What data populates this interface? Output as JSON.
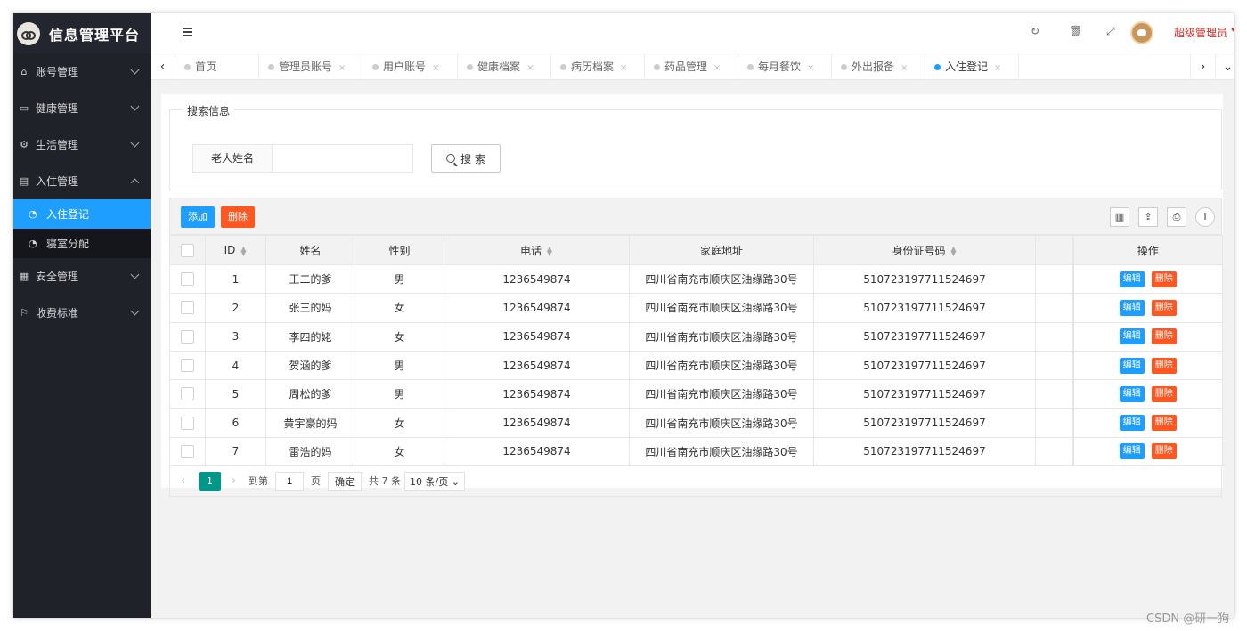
{
  "app": {
    "title": "信息管理平台"
  },
  "header": {
    "user_name": "超级管理员"
  },
  "sidebar": {
    "items": [
      {
        "label": "账号管理",
        "icon": "home-icon"
      },
      {
        "label": "健康管理",
        "icon": "window-icon"
      },
      {
        "label": "生活管理",
        "icon": "gears-icon"
      },
      {
        "label": "入住管理",
        "icon": "file-icon"
      },
      {
        "label": "安全管理",
        "icon": "calendar-icon"
      },
      {
        "label": "收费标准",
        "icon": "flag-icon"
      }
    ],
    "sub_items": [
      {
        "label": "入住登记",
        "icon": "dashboard-icon",
        "active": true
      },
      {
        "label": "寝室分配",
        "icon": "dashboard-icon",
        "active": false
      }
    ]
  },
  "tabs": [
    {
      "label": "首页"
    },
    {
      "label": "管理员账号",
      "close": "×"
    },
    {
      "label": "用户账号",
      "close": "×"
    },
    {
      "label": "健康档案",
      "close": "×"
    },
    {
      "label": "病历档案",
      "close": "×"
    },
    {
      "label": "药品管理",
      "close": "×"
    },
    {
      "label": "每月餐饮",
      "close": "×"
    },
    {
      "label": "外出报备",
      "close": "×"
    },
    {
      "label": "入住登记",
      "close": "×",
      "active": true
    }
  ],
  "search": {
    "legend": "搜索信息",
    "label": "老人姓名",
    "value": "",
    "button": "搜 索"
  },
  "toolbar": {
    "add_label": "添加",
    "delete_label": "删除"
  },
  "table": {
    "headers": [
      "ID",
      "姓名",
      "性别",
      "电话",
      "家庭地址",
      "身份证号码",
      "操作"
    ],
    "edit_label": "编辑",
    "delete_label": "删除",
    "rows": [
      {
        "id": "1",
        "name": "王二的爹",
        "gender": "男",
        "phone": "1236549874",
        "address": "四川省南充市顺庆区油缘路30号",
        "id_card": "510723197711524697"
      },
      {
        "id": "2",
        "name": "张三的妈",
        "gender": "女",
        "phone": "1236549874",
        "address": "四川省南充市顺庆区油缘路30号",
        "id_card": "510723197711524697"
      },
      {
        "id": "3",
        "name": "李四的姥",
        "gender": "女",
        "phone": "1236549874",
        "address": "四川省南充市顺庆区油缘路30号",
        "id_card": "510723197711524697"
      },
      {
        "id": "4",
        "name": "贺涵的爹",
        "gender": "男",
        "phone": "1236549874",
        "address": "四川省南充市顺庆区油缘路30号",
        "id_card": "510723197711524697"
      },
      {
        "id": "5",
        "name": "周松的爹",
        "gender": "男",
        "phone": "1236549874",
        "address": "四川省南充市顺庆区油缘路30号",
        "id_card": "510723197711524697"
      },
      {
        "id": "6",
        "name": "黄宇豪的妈",
        "gender": "女",
        "phone": "1236549874",
        "address": "四川省南充市顺庆区油缘路30号",
        "id_card": "510723197711524697"
      },
      {
        "id": "7",
        "name": "雷浩的妈",
        "gender": "女",
        "phone": "1236549874",
        "address": "四川省南充市顺庆区油缘路30号",
        "id_card": "510723197711524697"
      }
    ]
  },
  "pager": {
    "current": "1",
    "goto_label": "到第",
    "page_input": "1",
    "page_unit": "页",
    "confirm": "确定",
    "total": "共 7 条",
    "page_size": "10 条/页"
  },
  "watermark": "CSDN @研一狗",
  "colors": {
    "primary": "#1e9fff",
    "danger": "#ff5722",
    "sidebar_bg": "#20222a",
    "pager_active": "#009688"
  }
}
